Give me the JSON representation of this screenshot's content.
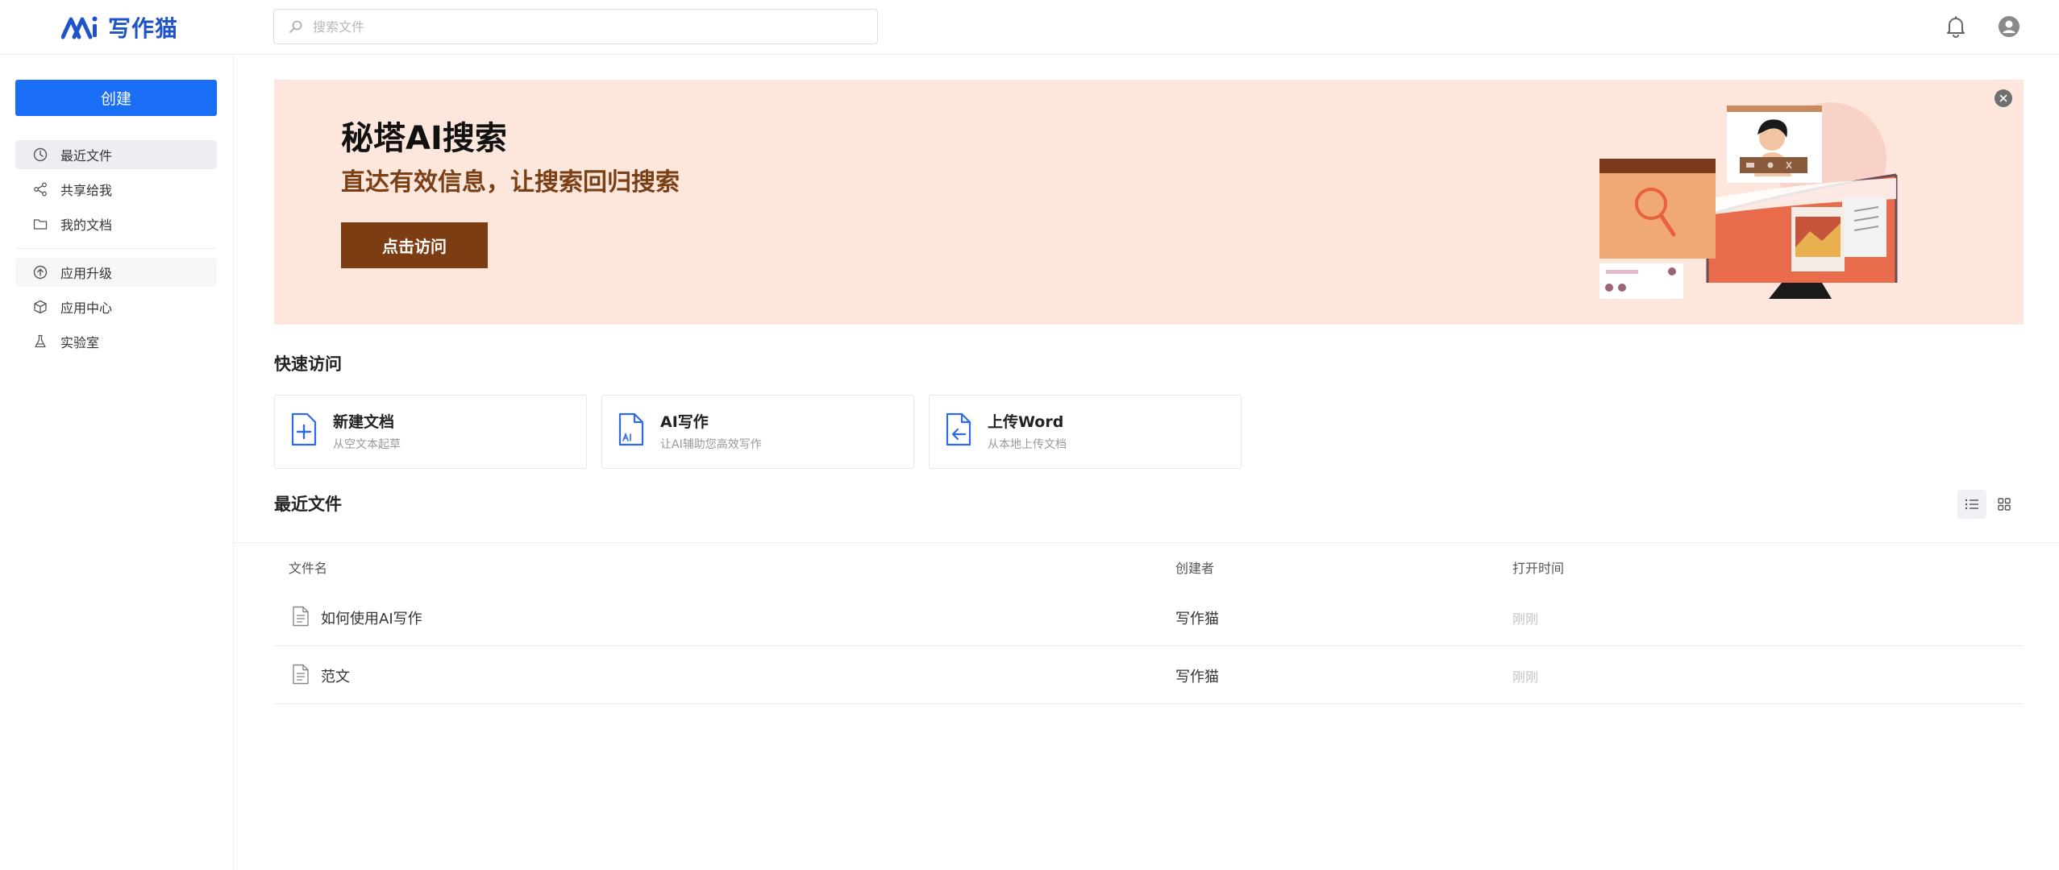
{
  "header": {
    "brand": "写作猫",
    "search_placeholder": "搜索文件"
  },
  "sidebar": {
    "create_label": "创建",
    "items": [
      {
        "label": "最近文件",
        "icon": "clock-icon"
      },
      {
        "label": "共享给我",
        "icon": "share-icon"
      },
      {
        "label": "我的文档",
        "icon": "folder-icon"
      },
      {
        "label": "应用升级",
        "icon": "upgrade-icon"
      },
      {
        "label": "应用中心",
        "icon": "cube-icon"
      },
      {
        "label": "实验室",
        "icon": "flask-icon"
      }
    ]
  },
  "banner": {
    "title": "秘塔AI搜索",
    "subtitle": "直达有效信息，让搜索回归搜索",
    "button_label": "点击访问"
  },
  "quick_access": {
    "title": "快速访问",
    "cards": [
      {
        "title": "新建文档",
        "desc": "从空文本起草",
        "icon": "new-doc-icon"
      },
      {
        "title": "AI写作",
        "desc": "让AI辅助您高效写作",
        "icon": "ai-doc-icon"
      },
      {
        "title": "上传Word",
        "desc": "从本地上传文档",
        "icon": "upload-doc-icon"
      }
    ]
  },
  "recent": {
    "title": "最近文件",
    "columns": [
      "文件名",
      "创建者",
      "打开时间"
    ],
    "rows": [
      {
        "name": "如何使用AI写作",
        "creator": "写作猫",
        "time": "刚刚"
      },
      {
        "name": "范文",
        "creator": "写作猫",
        "time": "刚刚"
      }
    ]
  },
  "colors": {
    "brand": "#1f54c9",
    "primary": "#1a6ef5",
    "banner_bg": "#fde6dc",
    "banner_button": "#7d3d12"
  }
}
